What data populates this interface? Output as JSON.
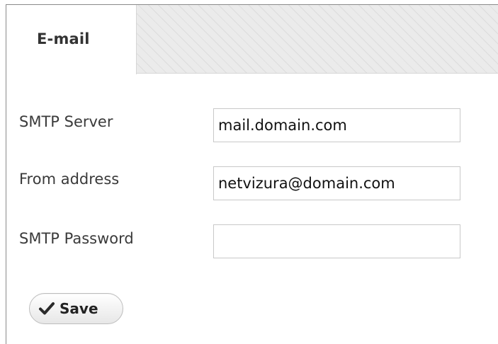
{
  "tabs": [
    {
      "label": "E-mail",
      "active": true
    }
  ],
  "form": {
    "smtp_server": {
      "label": "SMTP Server",
      "value": "mail.domain.com"
    },
    "from_address": {
      "label": "From address",
      "value": "netvizura@domain.com"
    },
    "smtp_password": {
      "label": "SMTP Password",
      "value": ""
    }
  },
  "actions": {
    "save_label": "Save",
    "save_icon": "checkmark-icon"
  },
  "colors": {
    "tab_fill": "#ebebeb",
    "stripe": "#dcdcdc",
    "border": "#8a8a8a",
    "input_border": "#c8c8c8"
  }
}
